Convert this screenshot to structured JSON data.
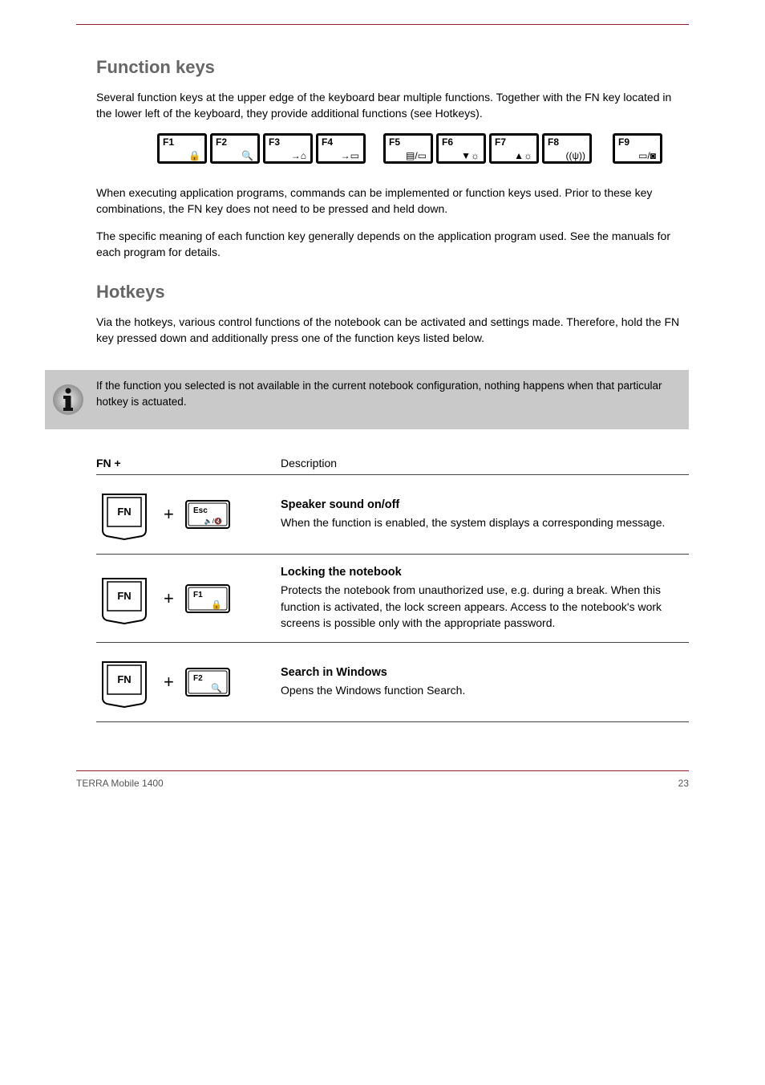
{
  "page": {
    "section_title_1": "Function keys",
    "intro_1": "Several function keys at the upper edge of the keyboard bear multiple functions. Together with the FN key located in the lower left of the keyboard, they provide additional functions (see Hotkeys).",
    "fkeys": [
      {
        "label": "F1",
        "icon_name": "lock-icon",
        "glyph": "🔒"
      },
      {
        "label": "F2",
        "icon_name": "search-icon",
        "glyph": "🔍"
      },
      {
        "label": "F3",
        "icon_name": "display-switch-icon",
        "glyph": "→⌂"
      },
      {
        "label": "F4",
        "icon_name": "display-off-icon",
        "glyph": "→▭"
      },
      {
        "label": "F5",
        "icon_name": "display-toggle-icon",
        "glyph": "▤/▭"
      },
      {
        "label": "F6",
        "icon_name": "brightness-down-icon",
        "glyph": "▼☼"
      },
      {
        "label": "F7",
        "icon_name": "brightness-up-icon",
        "glyph": "▲☼"
      },
      {
        "label": "F8",
        "icon_name": "wireless-icon",
        "glyph": "((ψ))"
      },
      {
        "label": "F9",
        "icon_name": "touchpad-camera-icon",
        "glyph": "▭/◙"
      }
    ],
    "func_paragraph_1": "When executing application programs, commands can be implemented or function keys used. Prior to these key combinations, the FN key does not need to be pressed and held down.",
    "func_paragraph_2": "The specific meaning of each function key generally depends on the application program used. See the manuals for each program for details.",
    "section_title_2": "Hotkeys",
    "hotkeys_intro": "Via the hotkeys, various control functions of the notebook can be activated and settings made. Therefore, hold the FN key pressed down and additionally press one of the function keys listed below.",
    "note_text": "If the function you selected is not available in the current notebook configuration, nothing happens when that particular hotkey is actuated.",
    "table_header_combo": "FN +",
    "table_header_desc": "Description",
    "rows": [
      {
        "combo_key": "Esc",
        "combo_key_icon": "sound-icon",
        "combo_glyph": "🔈/🔇",
        "title": "Speaker sound on/off",
        "body": "When the function is enabled, the system displays a corresponding message."
      },
      {
        "combo_key": "F1",
        "combo_key_icon": "lock-icon",
        "combo_glyph": "🔒",
        "title": "Locking the notebook",
        "body": "Protects the notebook from unauthorized use, e.g. during a break. When this function is activated, the lock screen appears. Access to the notebook's work screens is possible only with the appropriate password."
      },
      {
        "combo_key": "F2",
        "combo_key_icon": "search-icon",
        "combo_glyph": "🔍",
        "title": "Search in Windows",
        "body": "Opens the Windows function Search."
      }
    ]
  },
  "footer": {
    "left": "TERRA Mobile 1400",
    "right": "23"
  }
}
